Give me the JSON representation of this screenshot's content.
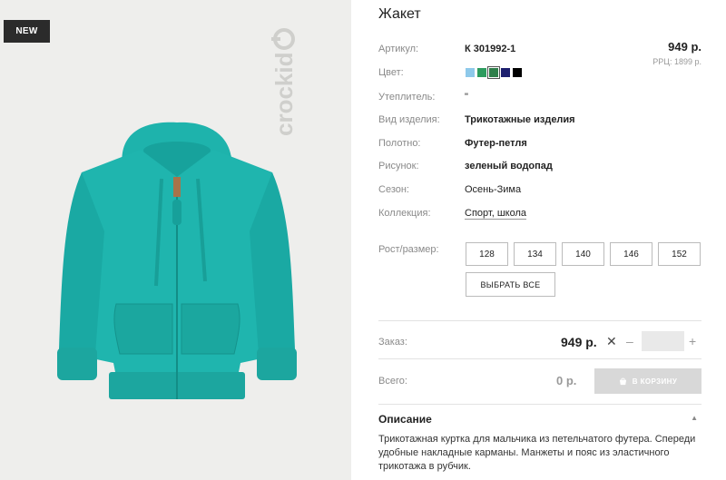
{
  "image": {
    "badge": "NEW",
    "brand": "crockid"
  },
  "product": {
    "title": "Жакет",
    "price": "949 р.",
    "rrp": "РРЦ: 1899 р.",
    "attributes": [
      {
        "label": "Артикул:",
        "value": "К 301992-1"
      },
      {
        "label": "Цвет:",
        "value": ""
      },
      {
        "label": "Утеплитель:",
        "value": "\""
      },
      {
        "label": "Вид изделия:",
        "value": "Трикотажные изделия"
      },
      {
        "label": "Полотно:",
        "value": "Футер-петля"
      },
      {
        "label": "Рисунок:",
        "value": "зеленый водопад"
      },
      {
        "label": "Сезон:",
        "value": "Осень-Зима"
      },
      {
        "label": "Коллекция:",
        "value": "Спорт, школа"
      }
    ],
    "colors": [
      "#8ec9ea",
      "#2e9c5f",
      "#2f7f4b",
      "#1d1f6e",
      "#000000"
    ],
    "selected_color_index": 2,
    "size_label": "Рост/размер:",
    "sizes": [
      "128",
      "134",
      "140",
      "146",
      "152"
    ],
    "select_all_label": "ВЫБРАТЬ ВСЕ"
  },
  "order": {
    "label": "Заказ:",
    "price": "949 р.",
    "times": "✕",
    "minus": "–",
    "plus": "+",
    "quantity": ""
  },
  "total": {
    "label": "Всего:",
    "price": "0 р.",
    "cart_button": "В КОРЗИНУ"
  },
  "description": {
    "heading": "Описание",
    "text": "Трикотажная куртка для мальчика из петельчатого футера. Спереди удобные накладные карманы. Манжеты и пояс из эластичного трикотажа в рубчик."
  }
}
